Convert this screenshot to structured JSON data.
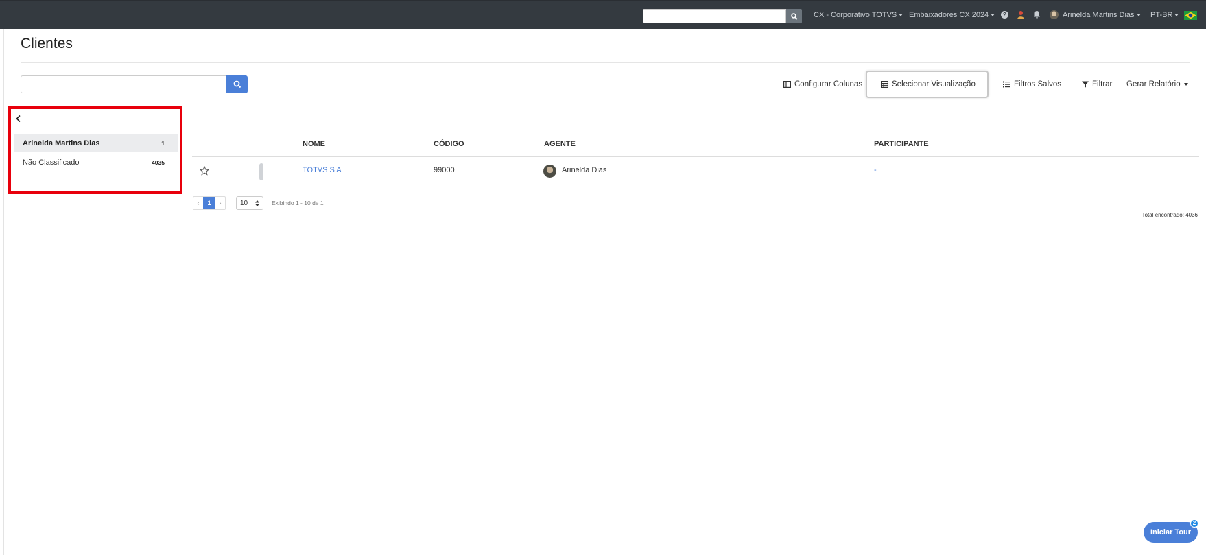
{
  "topbar": {
    "search_placeholder": "",
    "org": "CX - Corporativo TOTVS",
    "program": "Embaixadores CX 2024",
    "help_glyph": "?",
    "user": "Arinelda Martins Dias",
    "language": "PT-BR",
    "icons": [
      "search-icon",
      "help-icon",
      "person-icon",
      "bell-icon",
      "user-avatar",
      "brazil-flag-icon"
    ]
  },
  "page": {
    "title": "Clientes",
    "search_placeholder": ""
  },
  "toolbar": {
    "configure_columns": "Configurar Colunas",
    "select_view": "Selecionar Visualização",
    "saved_filters": "Filtros Salvos",
    "filter": "Filtrar",
    "report": "Gerar Relatório"
  },
  "groups": [
    {
      "label": "Arinelda Martins Dias",
      "count": "1",
      "active": true
    },
    {
      "label": "Não Classificado",
      "count": "4035",
      "active": false
    }
  ],
  "table": {
    "columns": [
      "NOME",
      "CÓDIGO",
      "AGENTE",
      "PARTICIPANTE"
    ],
    "rows": [
      {
        "name": "TOTVS S A",
        "code": "99000",
        "agent": "Arinelda Dias",
        "participant": "-"
      }
    ]
  },
  "pagination": {
    "prev": "‹",
    "current": "1",
    "next": "›",
    "per_page": "10",
    "showing": "Exibindo 1 - 10 de 1",
    "total": "Total encontrado: 4036"
  },
  "tour": {
    "label": "Iniciar Tour",
    "badge": "2"
  },
  "colors": {
    "topbar_bg": "#343a40",
    "accent": "#4a7fd8",
    "highlight_border": "#e8000c",
    "link": "#4a7fd8"
  }
}
